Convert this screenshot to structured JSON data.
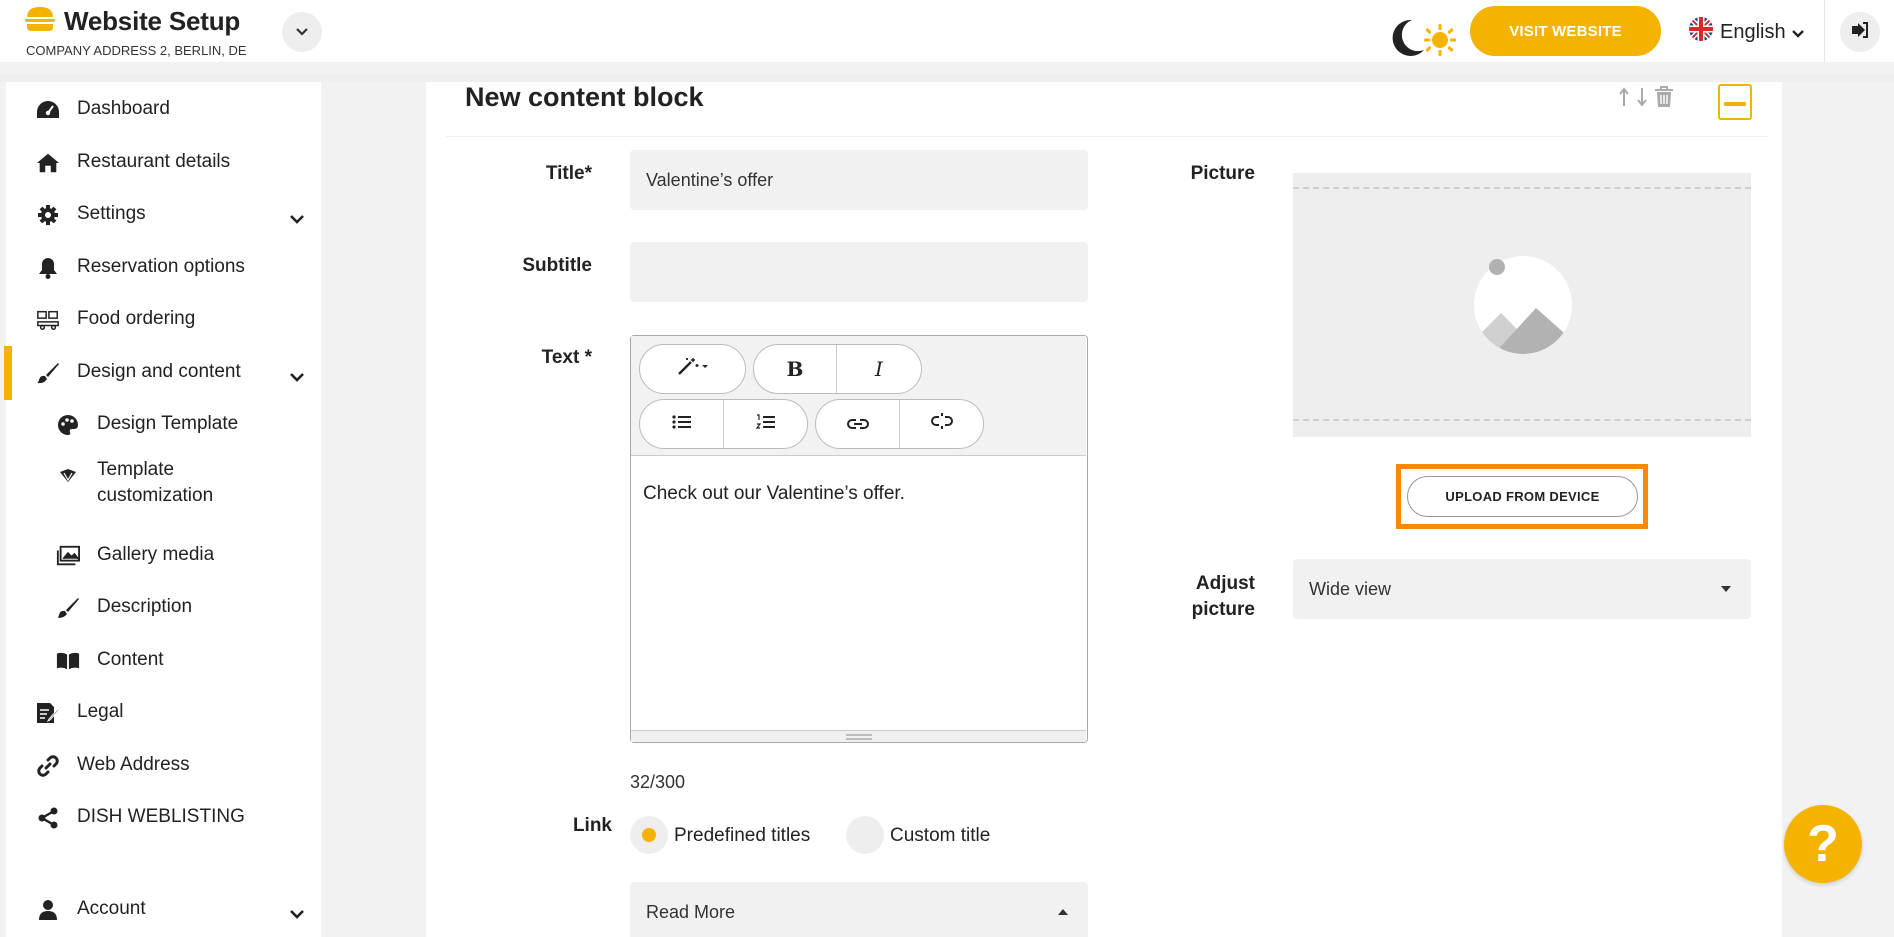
{
  "header": {
    "title": "Website Setup",
    "subtitle": "COMPANY ADDRESS 2, BERLIN, DE",
    "visit_label": "VISIT WEBSITE",
    "language": "English",
    "accent_color": "#f5b301"
  },
  "sidebar": {
    "items": [
      {
        "label": "Dashboard",
        "icon": "dashboard-icon"
      },
      {
        "label": "Restaurant details",
        "icon": "home-icon"
      },
      {
        "label": "Settings",
        "icon": "gear-icon"
      },
      {
        "label": "Reservation options",
        "icon": "bell-icon"
      },
      {
        "label": "Food ordering",
        "icon": "food-ordering-icon"
      },
      {
        "label": "Design and content",
        "icon": "brush-icon"
      },
      {
        "label": "Design Template",
        "icon": "palette-icon"
      },
      {
        "label": "Template",
        "label2": "customization",
        "icon": "template-icon"
      },
      {
        "label": "Gallery media",
        "icon": "gallery-icon"
      },
      {
        "label": "Description",
        "icon": "pen-icon"
      },
      {
        "label": "Content",
        "icon": "book-icon"
      },
      {
        "label": "Legal",
        "icon": "legal-icon"
      },
      {
        "label": "Web Address",
        "icon": "link-icon"
      },
      {
        "label": "DISH WEBLISTING",
        "icon": "share-icon"
      },
      {
        "label": "Account",
        "icon": "user-icon"
      }
    ]
  },
  "block": {
    "title": "New content block",
    "title_label": "Title*",
    "title_value": "Valentine’s offer",
    "subtitle_label": "Subtitle",
    "subtitle_value": "",
    "text_label": "Text *",
    "text_value": "Check out our Valentine’s offer.",
    "counter": "32/300",
    "link_label": "Link",
    "link_option_1": "Predefined titles",
    "link_option_2": "Custom title",
    "link_select": "Read More",
    "picture_label": "Picture",
    "upload_label": "UPLOAD FROM DEVICE",
    "adjust_label_1": "Adjust",
    "adjust_label_2": "picture",
    "adjust_value": "Wide view"
  },
  "toolbar": {
    "bold": "B",
    "italic": "I"
  },
  "help": {
    "label": "?"
  }
}
